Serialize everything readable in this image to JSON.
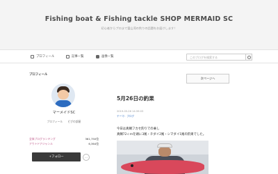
{
  "header": {
    "title": "Fishing boat & Fishing tackle SHOP MERMAID SC",
    "subtitle": "初心者からプロまで富山湾の釣りの話題をお届けします！"
  },
  "nav": {
    "items": [
      {
        "label": "プロフィール",
        "icon": "person-icon"
      },
      {
        "label": "記事一覧",
        "icon": "list-icon"
      },
      {
        "label": "画像一覧",
        "icon": "camera-icon"
      }
    ],
    "search_placeholder": "このブログを検索する"
  },
  "sidebar": {
    "heading": "プロフィール",
    "name": "マーメイドSC",
    "links": [
      "プロフィール",
      "ピグの部屋"
    ],
    "rankings": [
      {
        "label": "全体ブログランキング",
        "value": "361,750位"
      },
      {
        "label": "アウトドアジャンル",
        "value": "6,364位"
      }
    ],
    "follow_label": "+フォロー",
    "more_label": "…"
  },
  "main": {
    "page_button": "次ページへ",
    "post": {
      "title": "5月26日の釣果",
      "date": "2019-05-26 14:39:03",
      "theme": "テーマ：ブログ",
      "lines": [
        "今日は真鯛フカセ釣りでの乗し",
        "真鯛72ｃｍを頭に3尾・チダイ2尾・シマダイ1尾の釣果でした。"
      ]
    }
  },
  "colors": {
    "header_bg": "#f4f4f4",
    "link_blue": "#2b6cc4",
    "ranking_pink": "#c05a8a",
    "follow_bg": "#3a3a3a"
  }
}
